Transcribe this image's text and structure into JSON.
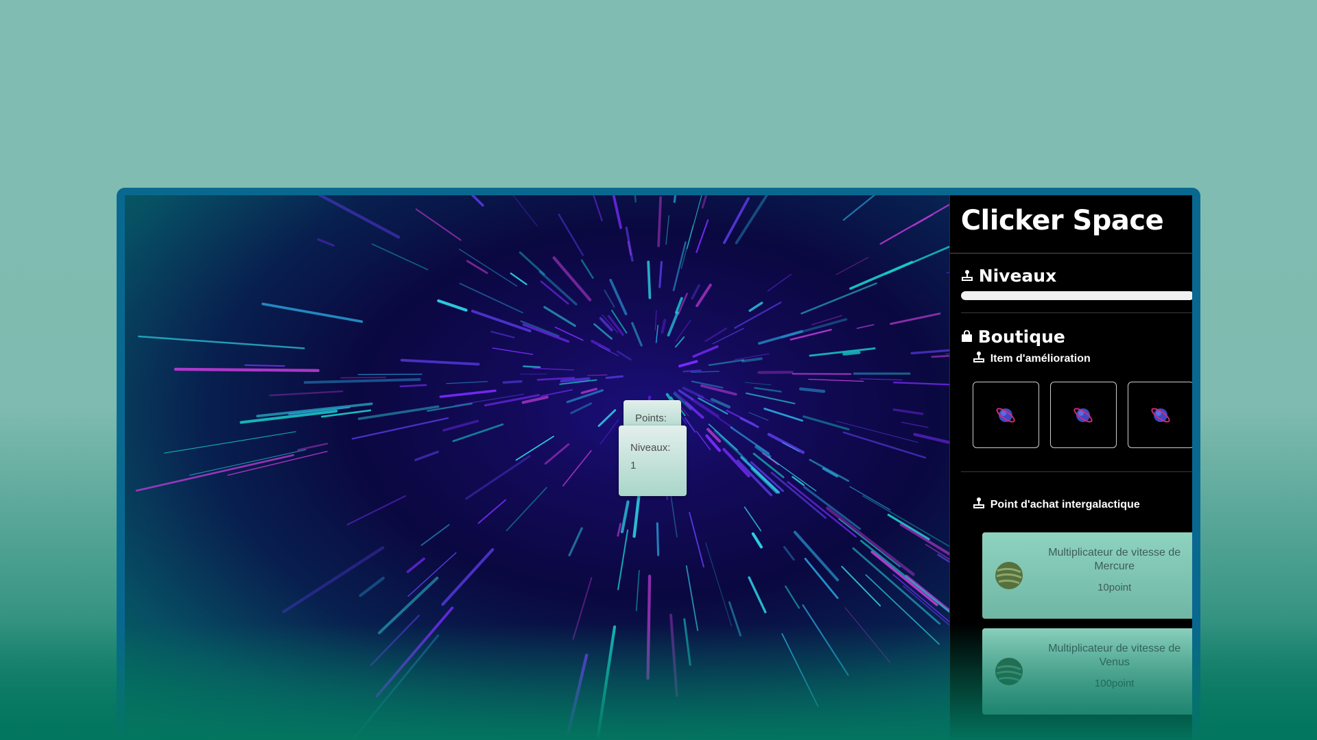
{
  "game": {
    "points_label": "Points:",
    "points_value": "",
    "level_label": "Niveaux:",
    "level_value": "1"
  },
  "sidebar": {
    "title": "Clicker Space",
    "levels": {
      "heading": "Niveaux",
      "progress": 1.0
    },
    "shop": {
      "heading": "Boutique",
      "upgrade_items": {
        "heading": "Item d'amélioration",
        "items": [
          {
            "icon": "planet-icon"
          },
          {
            "icon": "planet-icon"
          },
          {
            "icon": "planet-icon"
          }
        ]
      },
      "intergalactic": {
        "heading": "Point d'achat intergalactique",
        "cards": [
          {
            "title": "Multiplicateur de vitesse de Mercure",
            "price": "10point",
            "icon": "mercury-planet-icon"
          },
          {
            "title": "Multiplicateur de vitesse de Venus",
            "price": "100point",
            "icon": "venus-planet-icon"
          }
        ]
      }
    }
  },
  "colors": {
    "window_border": "#09688f",
    "sidebar_bg": "#000000",
    "card_bg": "#8ed3c0"
  }
}
